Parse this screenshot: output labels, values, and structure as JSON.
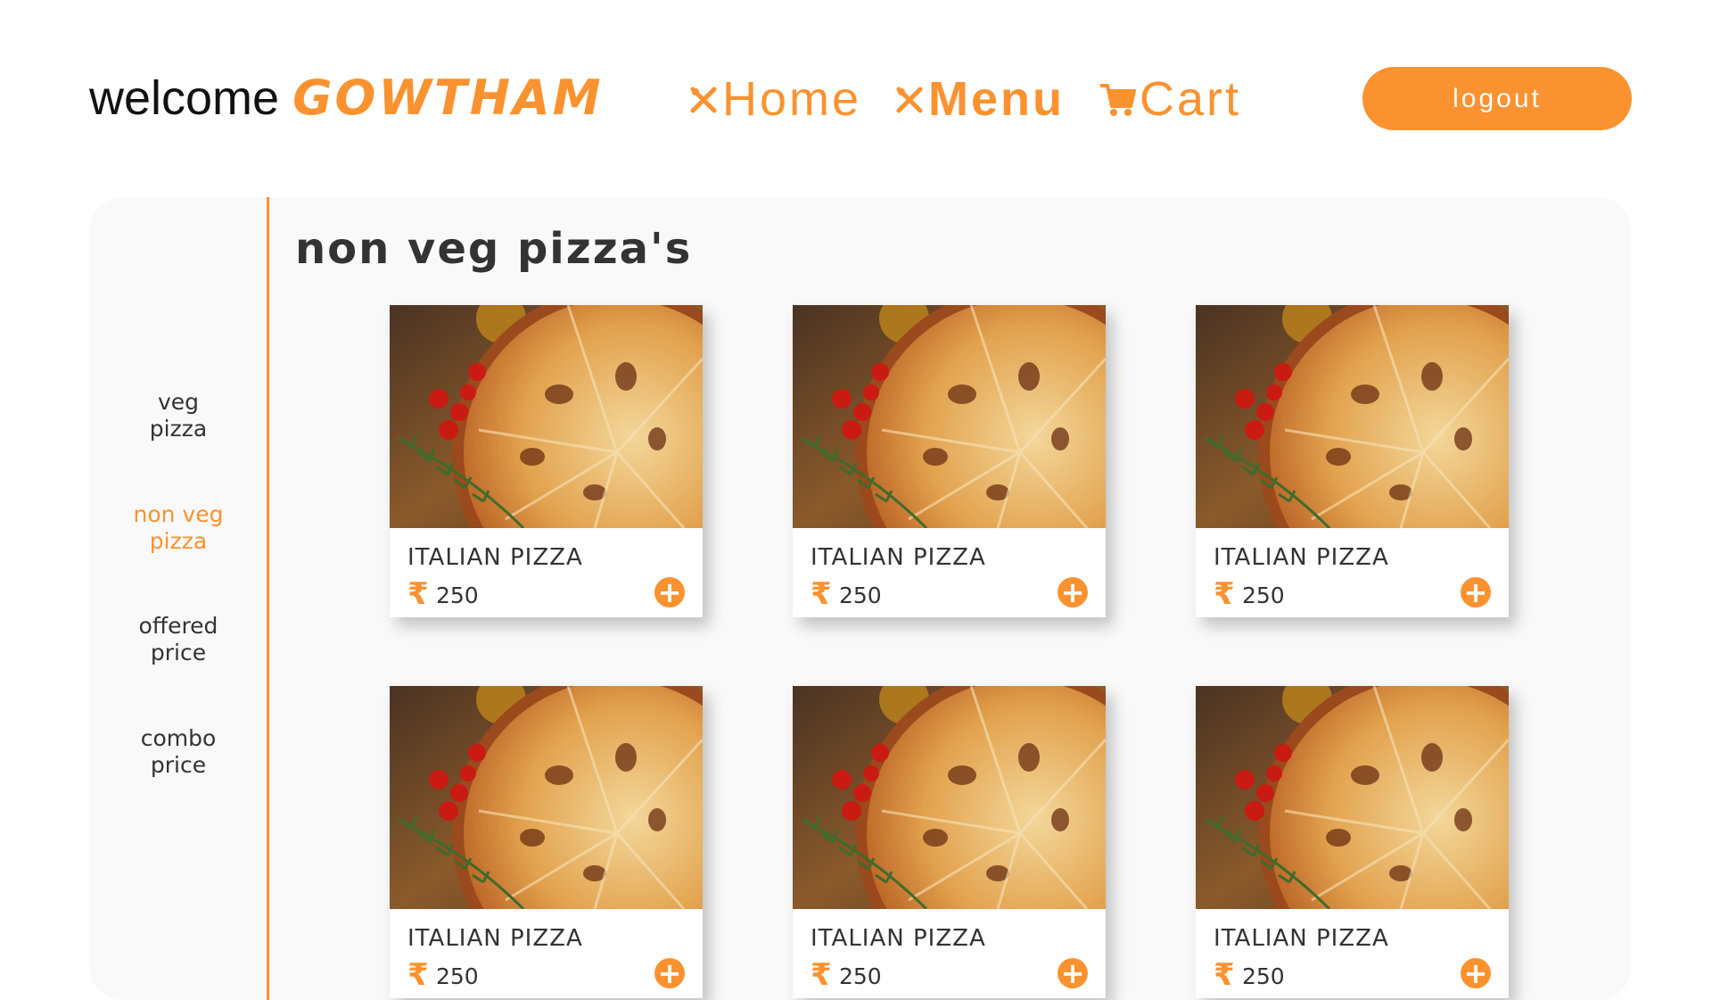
{
  "header": {
    "welcome_text": "welcome",
    "user_name": "GOWTHAM",
    "nav": [
      {
        "label": "Home",
        "icon": "fork-knife-icon",
        "active": false
      },
      {
        "label": "Menu",
        "icon": "fork-knife-icon",
        "active": true
      },
      {
        "label": "Cart",
        "icon": "cart-icon",
        "active": false
      }
    ],
    "logout_label": "logout"
  },
  "sidebar": {
    "items": [
      {
        "line1": "veg",
        "line2": "pizza",
        "active": false
      },
      {
        "line1": "non veg",
        "line2": "pizza",
        "active": true
      },
      {
        "line1": "offered",
        "line2": "price",
        "active": false
      },
      {
        "line1": "combo",
        "line2": "price",
        "active": false
      }
    ]
  },
  "section": {
    "title": "non veg pizza's"
  },
  "products": [
    {
      "name": "ITALIAN PIZZA",
      "currency": "₹",
      "price": "250"
    },
    {
      "name": "ITALIAN PIZZA",
      "currency": "₹",
      "price": "250"
    },
    {
      "name": "ITALIAN PIZZA",
      "currency": "₹",
      "price": "250"
    },
    {
      "name": "ITALIAN PIZZA",
      "currency": "₹",
      "price": "250"
    },
    {
      "name": "ITALIAN PIZZA",
      "currency": "₹",
      "price": "250"
    },
    {
      "name": "ITALIAN PIZZA",
      "currency": "₹",
      "price": "250"
    }
  ],
  "theme": {
    "accent": "#fb9230",
    "panel_bg": "#f9f9f9",
    "text": "#333333"
  }
}
